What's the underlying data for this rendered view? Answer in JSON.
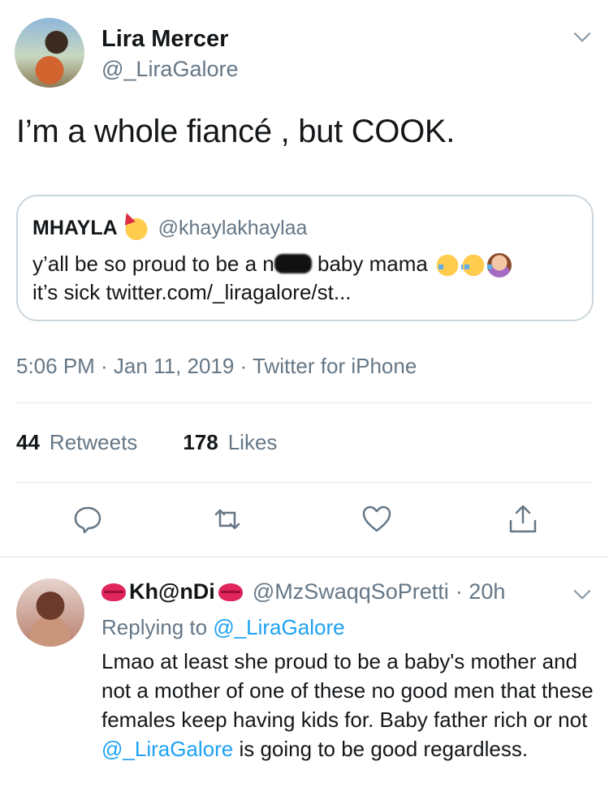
{
  "tweet": {
    "display_name": "Lira Mercer",
    "handle": "@_LiraGalore",
    "text": "I’m a whole fiancé , but COOK.",
    "timestamp": "5:06 PM · Jan 11, 2019 · Twitter for iPhone",
    "retweets_count": "44",
    "retweets_label": "Retweets",
    "likes_count": "178",
    "likes_label": "Likes"
  },
  "quoted": {
    "display_name": "MHAYLA",
    "handle": "@khaylakhaylaa",
    "text_before": "y’all be so proud to be a n",
    "text_after": " baby mama",
    "line2": "it’s sick twitter.com/_liragalore/st..."
  },
  "reply": {
    "display_name": "Kh@nDi",
    "handle": "@MzSwaqqSoPretti",
    "time": "· 20h",
    "replying_prefix": "Replying to",
    "replying_handle": "@_LiraGalore",
    "text_part1": "Lmao at least she proud to be a baby's mother and not a mother of one of these no good men that these females keep having kids for.  Baby father rich or not ",
    "mention": "@_LiraGalore",
    "text_part2": " is going to be good regardless."
  },
  "icons": [
    "chevron-down-icon",
    "reply-icon",
    "retweet-icon",
    "like-icon",
    "share-icon",
    "party-emoji",
    "crying-emoji",
    "facepalm-emoji",
    "kiss-emoji"
  ],
  "colors": {
    "text": "#14171a",
    "secondary": "#657786",
    "link": "#1da1f2",
    "border": "#ccd6dd"
  }
}
